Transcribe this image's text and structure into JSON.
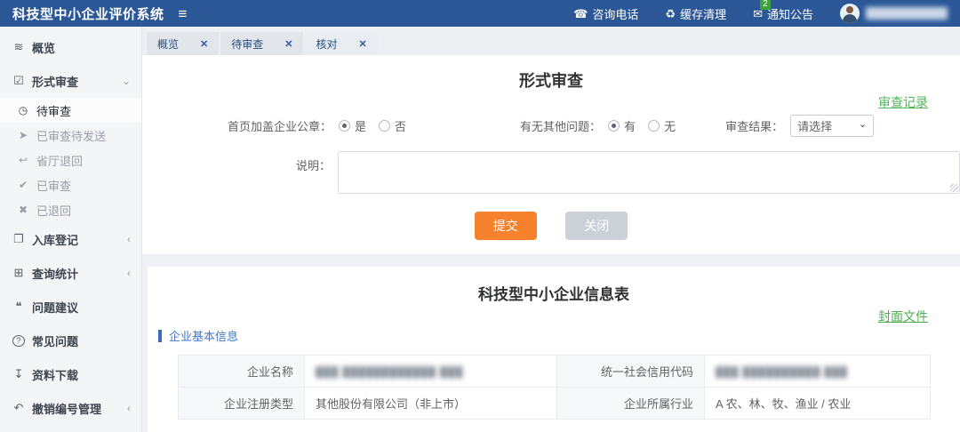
{
  "icons": {
    "hamburger": "≡",
    "phone": "☎",
    "cache": "♻",
    "notice": "✉",
    "overview": "≋",
    "form_review": "☑",
    "pending": "◷",
    "sent": "➤",
    "returned_dept": "↩",
    "reviewed": "✔",
    "rejected": "✖",
    "registry": "❐",
    "stats": "⊞",
    "feedback": "❝",
    "faq": "?",
    "download": "↧",
    "revoke": "↶",
    "chevron_down": "⌄",
    "chevron_left": "‹",
    "select_caret": "⌄",
    "tab_close": "✕"
  },
  "header": {
    "app_title": "科技型中小企业评价系统",
    "actions": [
      {
        "label": "咨询电话"
      },
      {
        "label": "缓存清理"
      },
      {
        "label": "通知公告",
        "badge": "2"
      }
    ],
    "user": {
      "name_blurred": "████████████"
    }
  },
  "sidebar": {
    "items": [
      {
        "label": "概览"
      },
      {
        "label": "形式审查",
        "expanded": true
      },
      {
        "label": "待审查",
        "sub": true,
        "active": true
      },
      {
        "label": "已审查待发送",
        "sub": true
      },
      {
        "label": "省厅退回",
        "sub": true
      },
      {
        "label": "已审查",
        "sub": true
      },
      {
        "label": "已退回",
        "sub": true
      },
      {
        "label": "入库登记",
        "collapsed": true
      },
      {
        "label": "查询统计",
        "collapsed": true
      },
      {
        "label": "问题建议"
      },
      {
        "label": "常见问题"
      },
      {
        "label": "资料下载"
      },
      {
        "label": "撤销编号管理",
        "collapsed": true
      }
    ]
  },
  "tabs": [
    {
      "label": "概览"
    },
    {
      "label": "待审查"
    },
    {
      "label": "核对",
      "active": true
    }
  ],
  "review_form": {
    "title": "形式审查",
    "records_link": "审查记录",
    "seal_label": "首页加盖企业公章：",
    "seal_option_yes": "是",
    "seal_option_no": "否",
    "seal_selected": "是",
    "issues_label": "有无其他问题：",
    "issues_option_yes": "有",
    "issues_option_no": "无",
    "issues_selected": "有",
    "result_label": "审查结果：",
    "result_value": "请选择",
    "note_label": "说明：",
    "note_value": "",
    "submit_label": "提交",
    "close_label": "关闭"
  },
  "info_card": {
    "title": "科技型中小企业信息表",
    "cover_link": "封面文件",
    "section_title": "企业基本信息",
    "table": {
      "row1": {
        "label1": "企业名称",
        "value1_redacted": "███ ████████████ ███",
        "label2": "统一社会信用代码",
        "value2_redacted": "███ ██████████ ███"
      },
      "row2": {
        "label1": "企业注册类型",
        "value1": "其他股份有限公司（非上市）",
        "label2": "企业所属行业",
        "value2": "A 农、林、牧、渔业 / 农业"
      }
    }
  }
}
